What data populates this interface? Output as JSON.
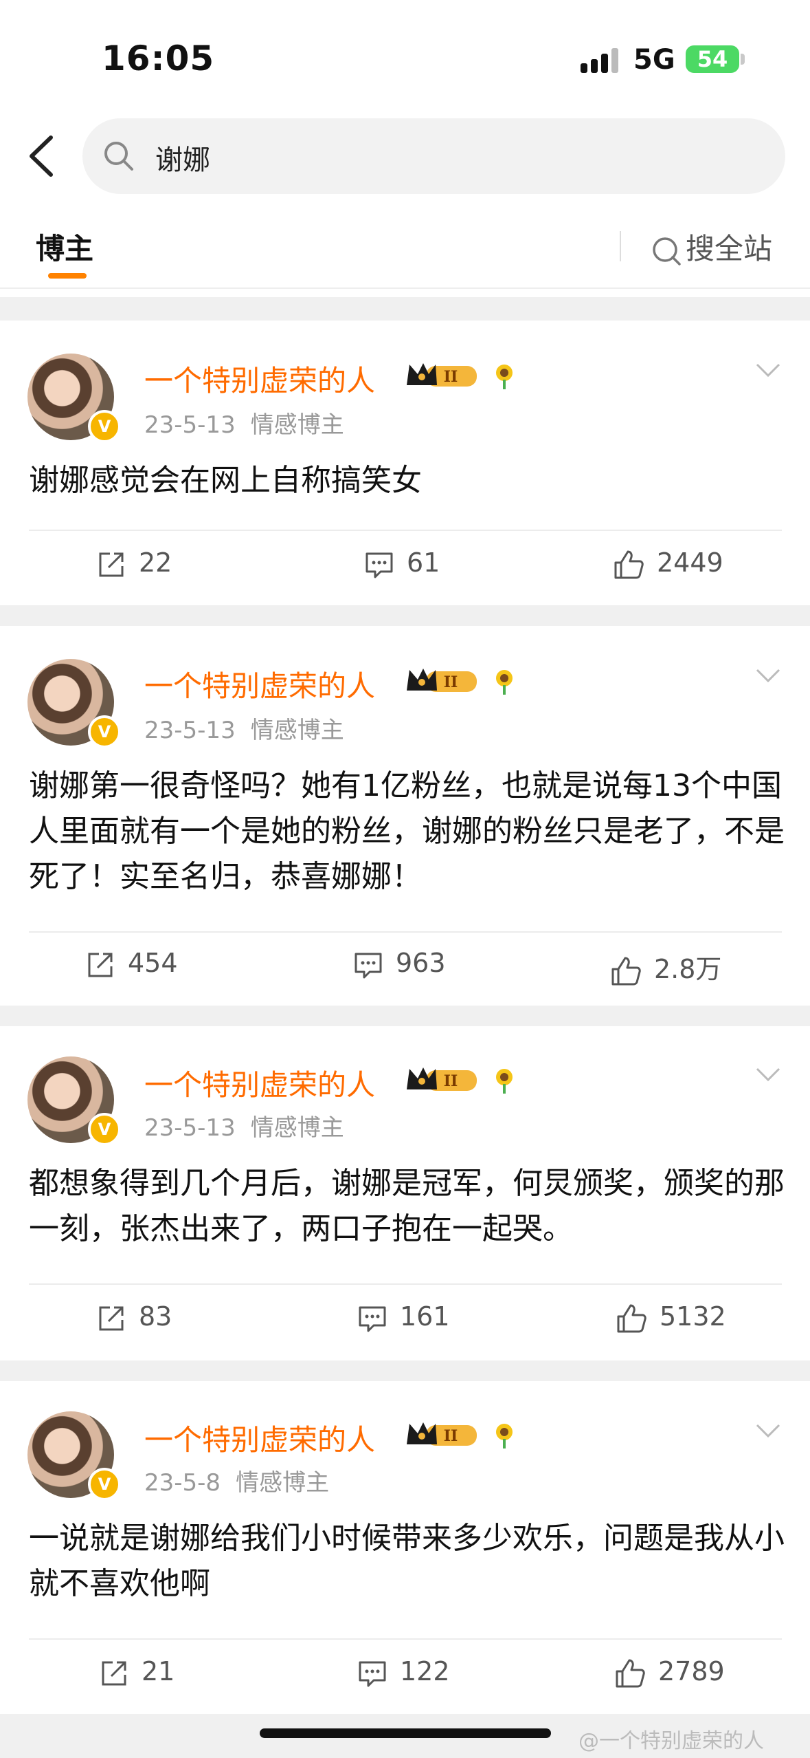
{
  "status_bar": {
    "time": "16:05",
    "network": "5G",
    "battery": "54"
  },
  "search": {
    "query": "谢娜"
  },
  "tabs": {
    "blogger": "博主",
    "search_all": "搜全站"
  },
  "colors": {
    "accent": "#ff8200",
    "username": "#ff6b00",
    "verified": "#f7b500",
    "battery": "#4cd964"
  },
  "posts": [
    {
      "username": "一个特别虚荣的人",
      "date": "23-5-13",
      "tag": "情感博主",
      "text": "谢娜感觉会在网上自称搞笑女",
      "reposts": "22",
      "comments": "61",
      "likes": "2449"
    },
    {
      "username": "一个特别虚荣的人",
      "date": "23-5-13",
      "tag": "情感博主",
      "text": "谢娜第一很奇怪吗？她有1亿粉丝，也就是说每13个中国人里面就有一个是她的粉丝，谢娜的粉丝只是老了，不是死了！实至名归，恭喜娜娜！",
      "reposts": "454",
      "comments": "963",
      "likes": "2.8万"
    },
    {
      "username": "一个特别虚荣的人",
      "date": "23-5-13",
      "tag": "情感博主",
      "text": "都想象得到几个月后，谢娜是冠军，何炅颁奖，颁奖的那一刻，张杰出来了，两口子抱在一起哭。",
      "reposts": "83",
      "comments": "161",
      "likes": "5132"
    },
    {
      "username": "一个特别虚荣的人",
      "date": "23-5-8",
      "tag": "情感博主",
      "text": "一说就是谢娜给我们小时候带来多少欢乐，问题是我从小就不喜欢他啊",
      "reposts": "21",
      "comments": "122",
      "likes": "2789"
    }
  ],
  "watermark": "@一个特别虚荣的人"
}
